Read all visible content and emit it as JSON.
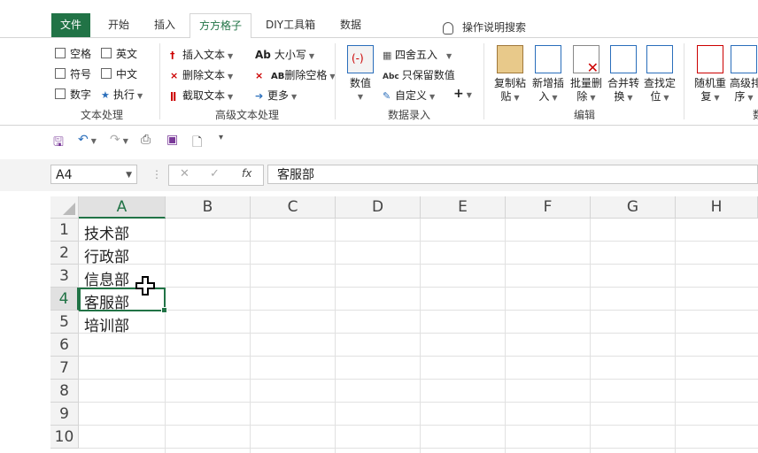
{
  "tabs": [
    "文件",
    "开始",
    "插入",
    "方方格子",
    "DIY工具箱",
    "数据"
  ],
  "help_search": "操作说明搜索",
  "ribbon": {
    "text_processing": {
      "label": "文本处理",
      "checkboxes": [
        "空格",
        "英文",
        "符号",
        "中文",
        "数字"
      ],
      "exec": "执行"
    },
    "advanced_text": {
      "label": "高级文本处理",
      "cmds": [
        "插入文本",
        "大小写",
        "删除文本",
        "删除空格",
        "截取文本",
        "更多"
      ],
      "icons": [
        "Ab",
        "AB"
      ]
    },
    "data_entry": {
      "label": "数据录入",
      "value_btn": "数值",
      "cmds": [
        "四舍五入",
        "只保留数值",
        "自定义"
      ],
      "abc_icon": "Abc"
    },
    "edit": {
      "label": "编辑",
      "buttons": [
        {
          "l1": "复制粘",
          "l2": "贴"
        },
        {
          "l1": "新增插",
          "l2": "入"
        },
        {
          "l1": "批量删",
          "l2": "除"
        },
        {
          "l1": "合并转",
          "l2": "换"
        },
        {
          "l1": "查找定",
          "l2": "位"
        }
      ]
    },
    "more": {
      "buttons": [
        {
          "l1": "随机重",
          "l2": "复"
        },
        {
          "l1": "高级排",
          "l2": "序"
        }
      ],
      "cut_label": "数"
    }
  },
  "name_box": "A4",
  "formula": "客服部",
  "columns": [
    "A",
    "B",
    "C",
    "D",
    "E",
    "F",
    "G",
    "H"
  ],
  "rows": [
    "1",
    "2",
    "3",
    "4",
    "5",
    "6",
    "7",
    "8",
    "9",
    "10"
  ],
  "cells": [
    "技术部",
    "行政部",
    "信息部",
    "客服部",
    "培训部"
  ],
  "accent": "#217346"
}
